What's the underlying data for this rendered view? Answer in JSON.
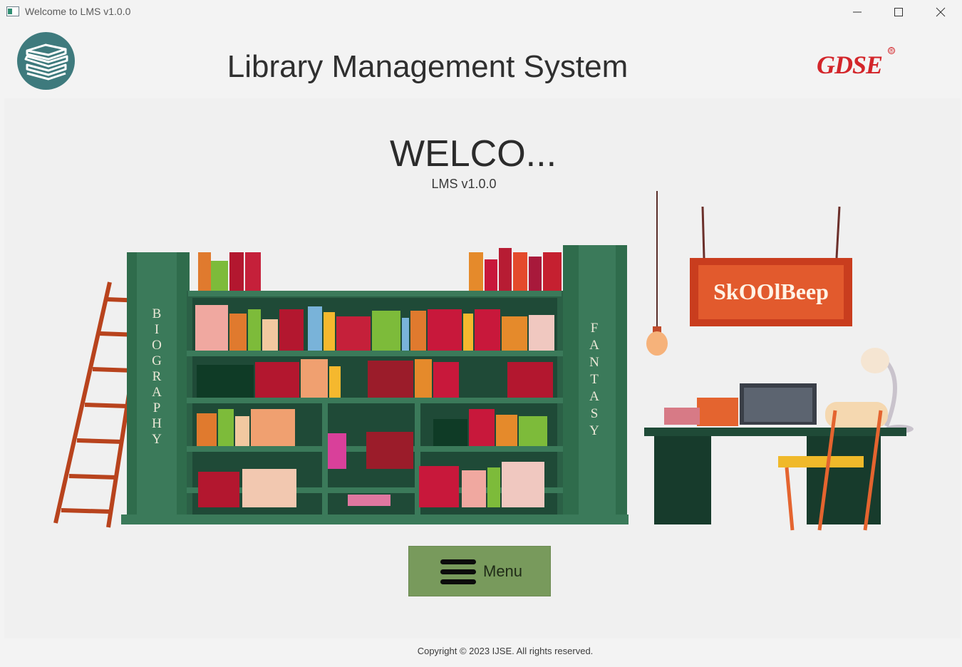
{
  "window": {
    "title": "Welcome to LMS v1.0.0",
    "controls": [
      "minimize",
      "maximize",
      "close"
    ]
  },
  "header": {
    "app_title": "Library Management System",
    "brand": "GDSE",
    "brand_mark": "®",
    "logo_icon": "books-stack-icon"
  },
  "main": {
    "welcome": "WELCO...",
    "version": "LMS v1.0.0",
    "illustration": {
      "shelf_left_label": "BIOGRAPHY",
      "shelf_right_label": "FANTASY",
      "sign_text": "SkOOlBeep"
    },
    "menu_button": {
      "label": "Menu",
      "icon": "hamburger-icon"
    }
  },
  "footer": {
    "copyright": "Copyright © 2023 IJSE. All rights reserved."
  },
  "colors": {
    "logo_bg": "#3e7a7d",
    "brand_red": "#d3252a",
    "menu_button": "#789a5c",
    "shelf_green": "#3b7a5a",
    "sign_orange": "#d4522a"
  }
}
